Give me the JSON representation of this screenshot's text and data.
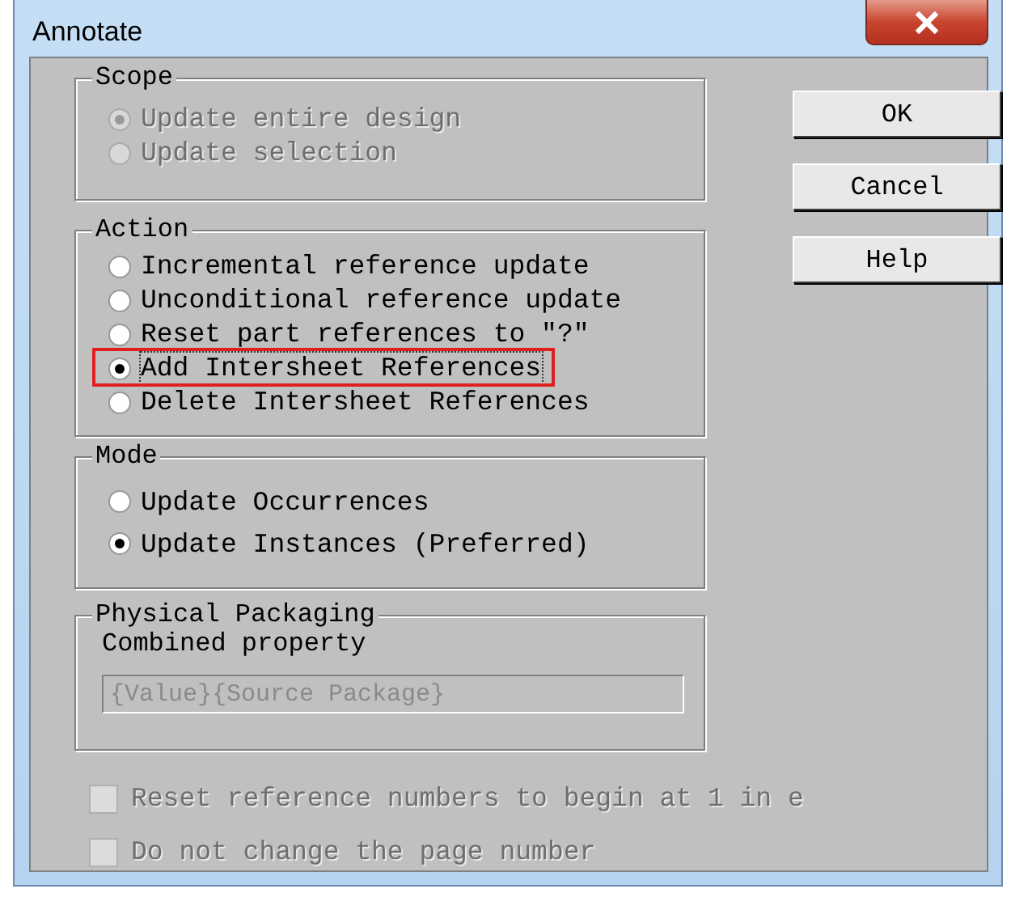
{
  "window": {
    "title": "Annotate"
  },
  "scope": {
    "label": "Scope",
    "options": [
      {
        "label": "Update entire design",
        "selected": true,
        "disabled": true
      },
      {
        "label": "Update selection",
        "selected": false,
        "disabled": true
      }
    ]
  },
  "action": {
    "label": "Action",
    "options": [
      {
        "label": "Incremental reference update",
        "selected": false,
        "highlighted": false
      },
      {
        "label": "Unconditional reference update",
        "selected": false,
        "highlighted": false
      },
      {
        "label": "Reset part references to \"?\"",
        "selected": false,
        "highlighted": false
      },
      {
        "label": "Add Intersheet References",
        "selected": true,
        "highlighted": true
      },
      {
        "label": "Delete Intersheet References",
        "selected": false,
        "highlighted": false
      }
    ]
  },
  "mode": {
    "label": "Mode",
    "options": [
      {
        "label": "Update Occurrences",
        "selected": false
      },
      {
        "label": "Update Instances (Preferred)",
        "selected": true
      }
    ]
  },
  "packaging": {
    "label": "Physical Packaging",
    "field_label": "Combined property",
    "value": "{Value}{Source Package}",
    "disabled": true
  },
  "checkboxes": [
    {
      "label": "Reset reference numbers to begin at 1 in e",
      "checked": false,
      "disabled": true
    },
    {
      "label": "Do not change the page number",
      "checked": false,
      "disabled": true
    }
  ],
  "buttons": [
    "OK",
    "Cancel",
    "Help"
  ]
}
